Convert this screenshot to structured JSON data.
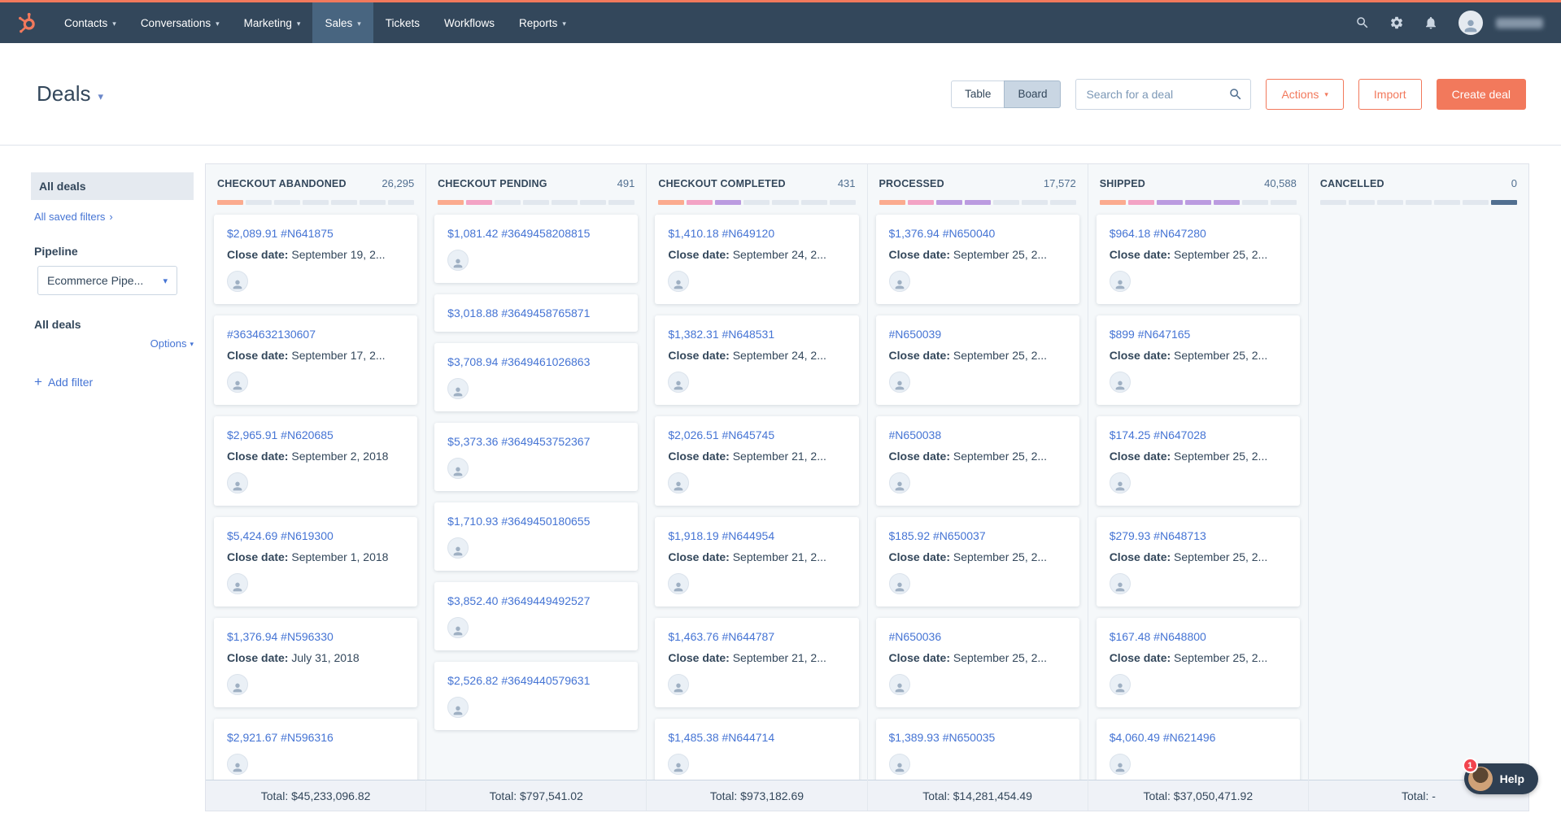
{
  "colors": {
    "brand_orange": "#f2795c",
    "nav_bg": "#33475b",
    "link_blue": "#4574d4",
    "board_bg": "#f5f8fa"
  },
  "nav": {
    "items": [
      {
        "label": "Contacts",
        "caret": true
      },
      {
        "label": "Conversations",
        "caret": true
      },
      {
        "label": "Marketing",
        "caret": true
      },
      {
        "label": "Sales",
        "caret": true,
        "active": true
      },
      {
        "label": "Tickets",
        "caret": false
      },
      {
        "label": "Workflows",
        "caret": false
      },
      {
        "label": "Reports",
        "caret": true
      }
    ]
  },
  "header": {
    "title": "Deals",
    "table_label": "Table",
    "board_label": "Board",
    "selected_view": "Board",
    "search_placeholder": "Search for a deal",
    "actions_label": "Actions",
    "import_label": "Import",
    "create_label": "Create deal"
  },
  "sidebar": {
    "all_deals_item": "All deals",
    "saved_filters": "All saved filters",
    "pipeline_label": "Pipeline",
    "pipeline_value": "Ecommerce Pipe...",
    "filter_scope": "All deals",
    "options_label": "Options",
    "add_filter_label": "Add filter"
  },
  "board": {
    "close_label": "Close date:",
    "stage_colors": {
      "o": "#fbab8f",
      "p": "#f3a3c5",
      "v": "#bb9be0",
      "g": "#e1e7ee",
      "d": "#516f90"
    },
    "columns": [
      {
        "name": "CHECKOUT ABANDONED",
        "count": "26,295",
        "total": "Total: $45,233,096.82",
        "segments": [
          "o",
          "g",
          "g",
          "g",
          "g",
          "g",
          "g"
        ],
        "cards": [
          {
            "title": "$2,089.91 #N641875",
            "close": "September 19, 2..."
          },
          {
            "title": "#3634632130607",
            "close": "September 17, 2..."
          },
          {
            "title": "$2,965.91 #N620685",
            "close": "September 2, 2018"
          },
          {
            "title": "$5,424.69 #N619300",
            "close": "September 1, 2018"
          },
          {
            "title": "$1,376.94 #N596330",
            "close": "July 31, 2018"
          },
          {
            "title": "$2,921.67 #N596316"
          }
        ]
      },
      {
        "name": "CHECKOUT PENDING",
        "count": "491",
        "total": "Total: $797,541.02",
        "segments": [
          "o",
          "p",
          "g",
          "g",
          "g",
          "g",
          "g"
        ],
        "cards": [
          {
            "title": "$1,081.42 #3649458208815"
          },
          {
            "title": "$3,018.88 #3649458765871",
            "no_avatar": true
          },
          {
            "title": "$3,708.94 #3649461026863"
          },
          {
            "title": "$5,373.36 #3649453752367"
          },
          {
            "title": "$1,710.93 #3649450180655"
          },
          {
            "title": "$3,852.40 #3649449492527"
          },
          {
            "title": "$2,526.82 #3649440579631"
          }
        ]
      },
      {
        "name": "CHECKOUT COMPLETED",
        "count": "431",
        "total": "Total: $973,182.69",
        "segments": [
          "o",
          "p",
          "v",
          "g",
          "g",
          "g",
          "g"
        ],
        "cards": [
          {
            "title": "$1,410.18 #N649120",
            "close": "September 24, 2..."
          },
          {
            "title": "$1,382.31 #N648531",
            "close": "September 24, 2..."
          },
          {
            "title": "$2,026.51 #N645745",
            "close": "September 21, 2..."
          },
          {
            "title": "$1,918.19 #N644954",
            "close": "September 21, 2..."
          },
          {
            "title": "$1,463.76 #N644787",
            "close": "September 21, 2..."
          },
          {
            "title": "$1,485.38 #N644714"
          }
        ]
      },
      {
        "name": "PROCESSED",
        "count": "17,572",
        "total": "Total: $14,281,454.49",
        "segments": [
          "o",
          "p",
          "v",
          "v",
          "g",
          "g",
          "g"
        ],
        "cards": [
          {
            "title": "$1,376.94 #N650040",
            "close": "September 25, 2..."
          },
          {
            "title": "#N650039",
            "close": "September 25, 2..."
          },
          {
            "title": "#N650038",
            "close": "September 25, 2..."
          },
          {
            "title": "$185.92 #N650037",
            "close": "September 25, 2..."
          },
          {
            "title": "#N650036",
            "close": "September 25, 2..."
          },
          {
            "title": "$1,389.93 #N650035"
          }
        ]
      },
      {
        "name": "SHIPPED",
        "count": "40,588",
        "total": "Total: $37,050,471.92",
        "segments": [
          "o",
          "p",
          "v",
          "v",
          "v",
          "g",
          "g"
        ],
        "cards": [
          {
            "title": "$964.18 #N647280",
            "close": "September 25, 2..."
          },
          {
            "title": "$899 #N647165",
            "close": "September 25, 2..."
          },
          {
            "title": "$174.25 #N647028",
            "close": "September 25, 2..."
          },
          {
            "title": "$279.93 #N648713",
            "close": "September 25, 2..."
          },
          {
            "title": "$167.48 #N648800",
            "close": "September 25, 2..."
          },
          {
            "title": "$4,060.49 #N621496"
          }
        ]
      },
      {
        "name": "CANCELLED",
        "count": "0",
        "total": "Total: -",
        "segments": [
          "g",
          "g",
          "g",
          "g",
          "g",
          "g",
          "d"
        ],
        "cards": []
      }
    ]
  },
  "help": {
    "label": "Help",
    "badge": "1"
  }
}
